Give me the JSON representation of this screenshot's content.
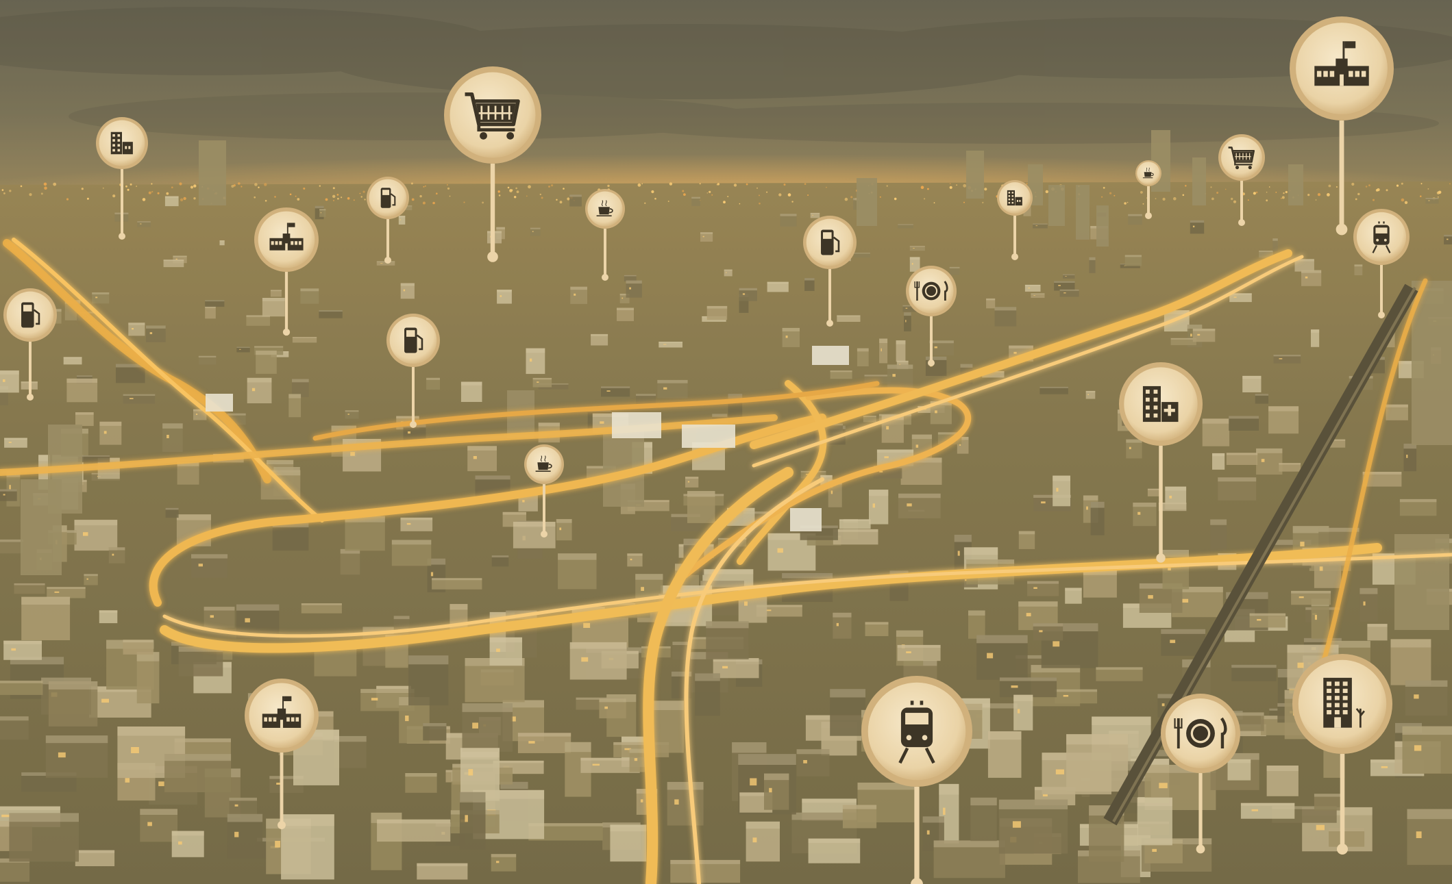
{
  "scene": {
    "description_name": "smart-city-aerial-night",
    "palette": {
      "sky_top": "#52544a",
      "sky_bottom": "#7a7558",
      "horizon_glow": "#e0a350",
      "city_base": "#6f6845",
      "city_dark": "#4e4a33",
      "highway": "#f3b443",
      "highway_glow": "#ffd27a",
      "pin_fill": "#efdcb6",
      "pin_ring": "#c9a978",
      "pin_stem": "#e8cfa3",
      "icon_color": "#3d3526",
      "overlay_tint": "#d8b77a"
    }
  },
  "pins": [
    {
      "id": "pin-office-left",
      "icon": "office-building-icon"
    },
    {
      "id": "pin-school-left",
      "icon": "school-icon"
    },
    {
      "id": "pin-fuel-top-left",
      "icon": "fuel-station-icon"
    },
    {
      "id": "pin-shopping-cart-big",
      "icon": "shopping-cart-icon"
    },
    {
      "id": "pin-coffee-top",
      "icon": "coffee-cup-icon"
    },
    {
      "id": "pin-fuel-far-left",
      "icon": "fuel-station-icon"
    },
    {
      "id": "pin-fuel-mid-left",
      "icon": "fuel-station-icon"
    },
    {
      "id": "pin-fuel-center",
      "icon": "fuel-station-icon"
    },
    {
      "id": "pin-restaurant-center",
      "icon": "restaurant-plate-icon"
    },
    {
      "id": "pin-office-center",
      "icon": "office-building-icon"
    },
    {
      "id": "pin-coffee-small",
      "icon": "coffee-cup-icon"
    },
    {
      "id": "pin-shopping-cart-small",
      "icon": "shopping-cart-icon"
    },
    {
      "id": "pin-school-big",
      "icon": "school-icon"
    },
    {
      "id": "pin-train-small",
      "icon": "train-icon"
    },
    {
      "id": "pin-hospital",
      "icon": "hospital-icon"
    },
    {
      "id": "pin-coffee-mid",
      "icon": "coffee-cup-icon"
    },
    {
      "id": "pin-school-bottom",
      "icon": "school-icon"
    },
    {
      "id": "pin-train-big",
      "icon": "train-icon"
    },
    {
      "id": "pin-restaurant-bottom",
      "icon": "restaurant-plate-icon"
    },
    {
      "id": "pin-hotel",
      "icon": "hotel-building-icon"
    }
  ]
}
